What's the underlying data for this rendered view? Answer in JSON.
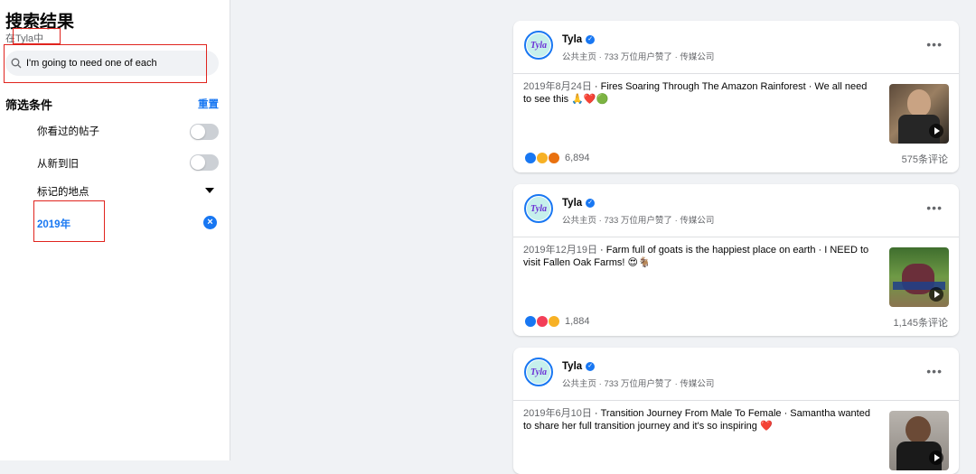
{
  "sidebar": {
    "title": "搜索结果",
    "subtitle": "在Tyla中",
    "search_value": "I'm going to need one of each",
    "filters_label": "筛选条件",
    "reset_label": "重置",
    "filters": [
      {
        "label": "你看过的帖子"
      },
      {
        "label": "从新到旧"
      },
      {
        "label": "标记的地点"
      }
    ],
    "selected_year": "2019年"
  },
  "posts": [
    {
      "author": "Tyla",
      "meta": "公共主页 · 733 万位用户赞了 · 传媒公司",
      "date": "2019年8月24日",
      "text": " · Fires Soaring Through The Amazon Rainforest · We all need to see this 🙏❤️🟢",
      "reaction_count": "6,894",
      "comments": "575条评论"
    },
    {
      "author": "Tyla",
      "meta": "公共主页 · 733 万位用户赞了 · 传媒公司",
      "date": "2019年12月19日",
      "text": " · Farm full of goats is the happiest place on earth · I NEED to visit Fallen Oak Farms! 😍🐐",
      "reaction_count": "1,884",
      "comments": "1,145条评论"
    },
    {
      "author": "Tyla",
      "meta": "公共主页 · 733 万位用户赞了 · 传媒公司",
      "date": "2019年6月10日",
      "text": " · Transition Journey From Male To Female · Samantha wanted to share her full transition journey and it's so inspiring ❤️",
      "reaction_count": "",
      "comments": ""
    }
  ],
  "logo_text": "Tyla"
}
